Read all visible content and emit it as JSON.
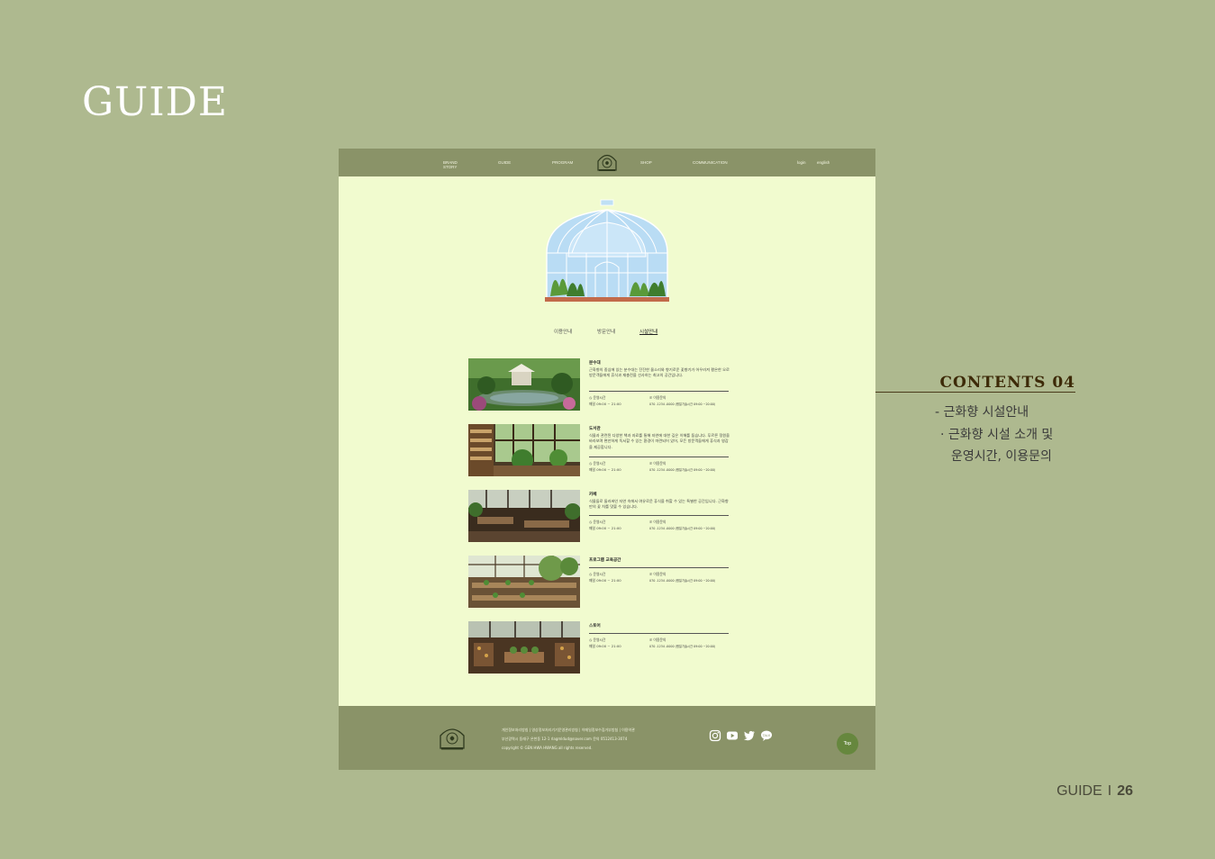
{
  "slide": {
    "title": "GUIDE",
    "page_label": "GUIDE",
    "page_sep": "I",
    "page_number": "26"
  },
  "contents": {
    "heading": "CONTENTS 04",
    "line1": "- 근화향 시설안내",
    "line2": "· 근화향 시설 소개 및",
    "line3": "운영시간, 이용문의"
  },
  "nav": {
    "items": [
      "BRAND",
      "STORY",
      "GUIDE",
      "PROGRAM",
      "SHOP",
      "COMMUNICATION"
    ],
    "login": "login",
    "lang": "english",
    "logo_icon": "greenhouse-emblem-icon"
  },
  "tabs": [
    "이용안내",
    "방문안내",
    "시설안내"
  ],
  "active_tab": "시설안내",
  "facilities": [
    {
      "title": "분수대",
      "desc": "근화향의 중심에 있는 분수대는 잔잔한 물소리와 향기로운 꽃향기가 어우러져 평온한 오로 방문객들에게 휴식과 재충전을 선사하는 최고의 공간입니다.",
      "hours_label": "운영시간",
      "hours": "매일 09:00 ~ 21:00",
      "contact_label": "이용문의",
      "contact": "070 -1234 -0000 (평일기술시간 09:00 ~20:00)",
      "photo": "fountain-garden-photo"
    },
    {
      "title": "도서관",
      "desc": "식물과 관련된 다양한 책과 자료를 통해 자연에 대한 깊은 이해를 돕습니다. 푸르른 정원을 바라보며 편안하게 독서할 수 있는 환경이 마련되어 있어, 모든 방문객들에게 휴식과 영감을 제공합니다.",
      "hours_label": "운영시간",
      "hours": "매일 09:00 ~ 21:00",
      "contact_label": "이용문의",
      "contact": "070 -1234 -0000 (평일기술시간 09:00 ~20:00)",
      "photo": "library-photo"
    },
    {
      "title": "카페",
      "desc": "식물들로 둘러싸인 자연 속에서 여유로운 휴식을 취할 수 있는 특별한 공간입니다. 근화향만의 꽃 차를 맛볼 수 있습니다.",
      "hours_label": "운영시간",
      "hours": "매일 09:00 ~ 21:00",
      "contact_label": "이용문의",
      "contact": "070 -1234 -0000 (평일기술시간 09:00 ~20:00)",
      "photo": "cafe-photo"
    },
    {
      "title": "프로그램 교육공간",
      "desc": "",
      "hours_label": "운영시간",
      "hours": "매일 09:00 ~ 21:00",
      "contact_label": "이용문의",
      "contact": "070 -1234 -0000 (평일기술시간 09:00 ~20:00)",
      "photo": "education-room-photo"
    },
    {
      "title": "스토어",
      "desc": "",
      "hours_label": "운영시간",
      "hours": "매일 09:00 ~ 21:00",
      "contact_label": "이용문의",
      "contact": "070 -1234 -0000 (평일기술시간 09:00 ~20:00)",
      "photo": "store-photo"
    }
  ],
  "footer": {
    "links": "개인정보처리방침 | 영상정보처리기기운영관리방침 | 이메일정보수집거부방침 | 이용약관",
    "address": "부산광역시 동래구 온천동 12-1 rlagmldud@naver.com 문의 0512413-3074",
    "copyright": "copyright © GEN HWA HWANG all rights reserved.",
    "sns": [
      "instagram-icon",
      "youtube-icon",
      "twitter-icon",
      "kakaotalk-icon"
    ],
    "top_label": "Top"
  },
  "colors": {
    "background": "#aeb98f",
    "page": "#f1fbcf",
    "bar": "#8a9368",
    "accent": "#66873e",
    "heading": "#3d2a08"
  }
}
